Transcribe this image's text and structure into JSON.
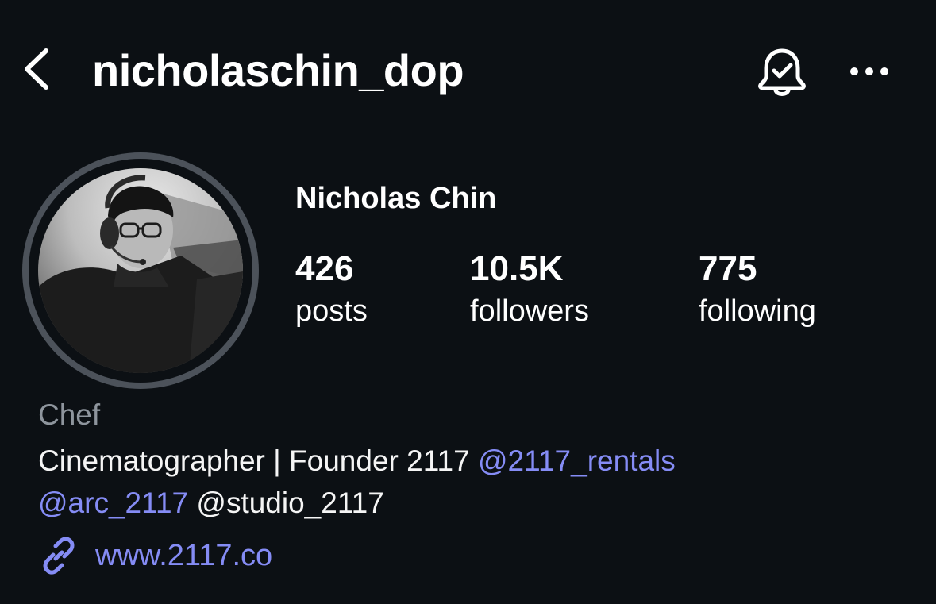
{
  "header": {
    "username": "nicholaschin_dop",
    "back_icon": "chevron-left-icon",
    "bell_icon": "bell-check-icon",
    "more_icon": "ellipsis-horizontal-icon"
  },
  "profile": {
    "display_name": "Nicholas Chin",
    "avatar_ring_color": "#4c525a"
  },
  "stats": [
    {
      "value": "426",
      "label": "posts"
    },
    {
      "value": "10.5K",
      "label": "followers"
    },
    {
      "value": "775",
      "label": "following"
    }
  ],
  "bio": {
    "category": "Chef",
    "line1_text": "Cinematographer | Founder 2117 ",
    "line1_mention": "@2117_rentals",
    "line2_mention": "@arc_2117",
    "line2_text": " @studio_2117"
  },
  "website": {
    "icon": "link-icon",
    "url": "www.2117.co"
  },
  "colors": {
    "background": "#0c1014",
    "text": "#f5f5f5",
    "muted": "#8e959d",
    "link": "#858cf5"
  }
}
